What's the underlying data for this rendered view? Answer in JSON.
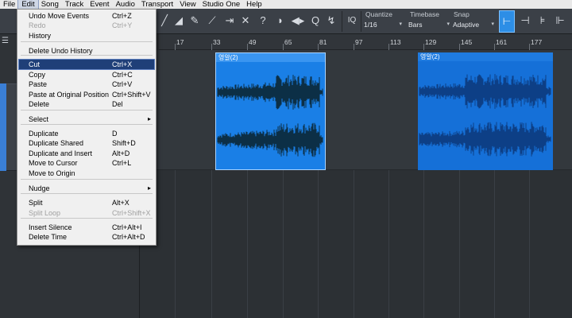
{
  "menubar": {
    "items": [
      "File",
      "Edit",
      "Song",
      "Track",
      "Event",
      "Audio",
      "Transport",
      "View",
      "Studio One",
      "Help"
    ]
  },
  "toolbar": {
    "iq_label": "IQ",
    "quantize_label": "Quantize",
    "quantize_value": "1/16",
    "timebase_label": "Timebase",
    "timebase_value": "Bars",
    "snap_label": "Snap",
    "snap_value": "Adaptive"
  },
  "ruler": {
    "ticks": [
      "17",
      "33",
      "49",
      "65",
      "81",
      "97",
      "113",
      "129",
      "145",
      "161",
      "177"
    ]
  },
  "clips": [
    {
      "name": "영알(2)",
      "selected": true,
      "color": "#1a7fe6"
    },
    {
      "name": "영알(2)",
      "selected": false,
      "color": "#1570d8"
    }
  ],
  "edit_menu": {
    "items": [
      {
        "label": "Undo Move Events",
        "shortcut": "Ctrl+Z",
        "enabled": true
      },
      {
        "label": "Redo",
        "shortcut": "Ctrl+Y",
        "enabled": false
      },
      {
        "label": "History",
        "shortcut": "",
        "enabled": true
      },
      {
        "label": "Delete Undo History",
        "shortcut": "",
        "enabled": true
      },
      {
        "label": "Cut",
        "shortcut": "Ctrl+X",
        "enabled": true,
        "highlighted": true
      },
      {
        "label": "Copy",
        "shortcut": "Ctrl+C",
        "enabled": true
      },
      {
        "label": "Paste",
        "shortcut": "Ctrl+V",
        "enabled": true
      },
      {
        "label": "Paste at Original Position",
        "shortcut": "Ctrl+Shift+V",
        "enabled": true
      },
      {
        "label": "Delete",
        "shortcut": "Del",
        "enabled": true
      },
      {
        "label": "Select",
        "shortcut": "",
        "enabled": true,
        "submenu": true
      },
      {
        "label": "Duplicate",
        "shortcut": "D",
        "enabled": true
      },
      {
        "label": "Duplicate Shared",
        "shortcut": "Shift+D",
        "enabled": true
      },
      {
        "label": "Duplicate and Insert",
        "shortcut": "Alt+D",
        "enabled": true
      },
      {
        "label": "Move to Cursor",
        "shortcut": "Ctrl+L",
        "enabled": true
      },
      {
        "label": "Move to Origin",
        "shortcut": "",
        "enabled": true
      },
      {
        "label": "Nudge",
        "shortcut": "",
        "enabled": true,
        "submenu": true
      },
      {
        "label": "Split",
        "shortcut": "Alt+X",
        "enabled": true
      },
      {
        "label": "Split Loop",
        "shortcut": "Ctrl+Shift+X",
        "enabled": false
      },
      {
        "label": "Insert Silence",
        "shortcut": "Ctrl+Alt+I",
        "enabled": true
      },
      {
        "label": "Delete Time",
        "shortcut": "Ctrl+Alt+D",
        "enabled": true
      }
    ]
  },
  "icons": {
    "submenu_arrow": "▸",
    "dropdown_arrow": "▾"
  },
  "colors": {
    "accent": "#2d8ee6",
    "menu_highlight": "#1f3f78",
    "clip_selected": "#1a7fe6",
    "clip_unselected": "#1570d8"
  }
}
